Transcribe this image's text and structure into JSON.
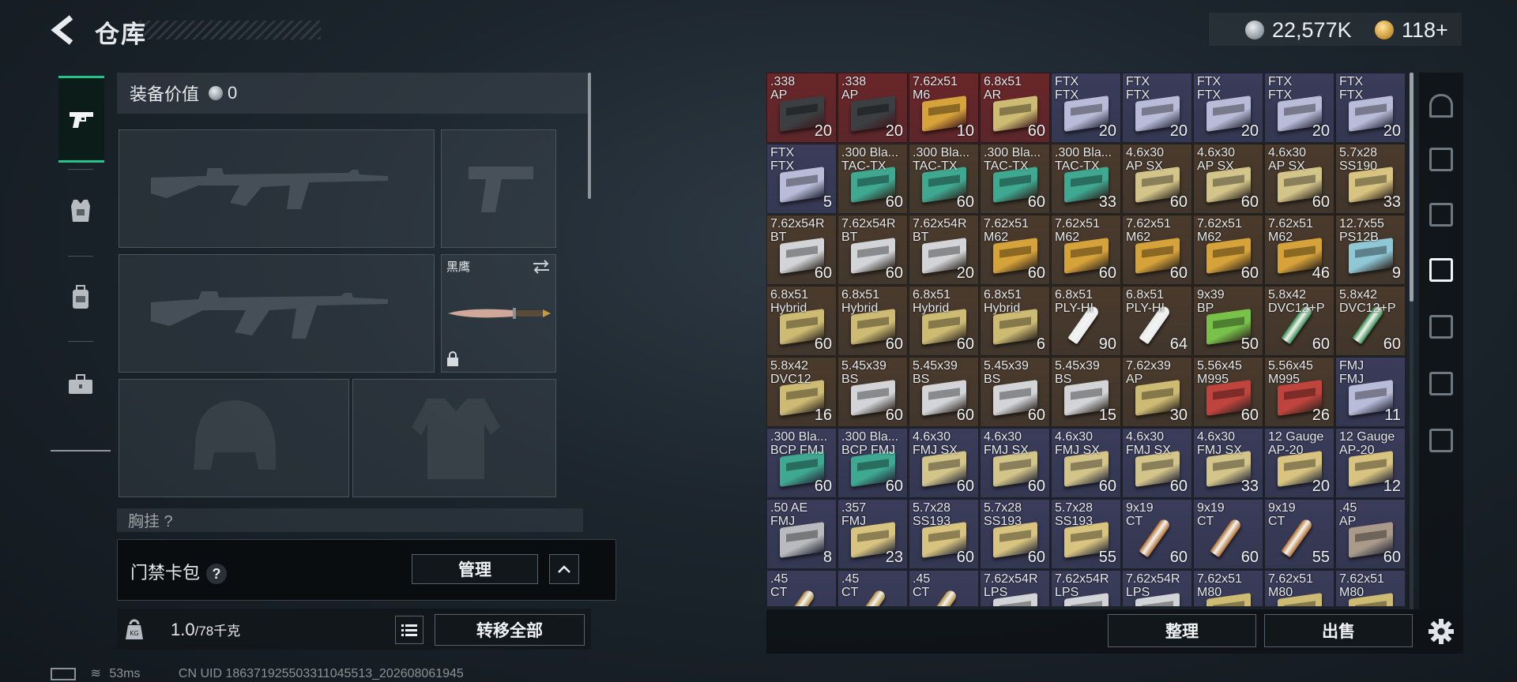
{
  "header": {
    "title": "仓库",
    "currencies": [
      {
        "icon": "silver-coin-icon",
        "value": "22,577K"
      },
      {
        "icon": "gold-coin-icon",
        "value": "118+"
      }
    ]
  },
  "left_rail": {
    "items": [
      {
        "icon": "pistol-icon",
        "active": true
      },
      {
        "icon": "armor-vest-icon",
        "active": false
      },
      {
        "icon": "backpack-icon",
        "active": false
      },
      {
        "icon": "toolbox-icon",
        "active": false
      }
    ]
  },
  "equipment": {
    "value_label": "装备价值",
    "value": "0",
    "melee_name": "黑鹰",
    "chest_rig_label": "胸挂 ?",
    "key_bag_label": "门禁卡包",
    "help_mark": "?",
    "manage_label": "管理",
    "weight_value": "1.0",
    "weight_max": "/78千克",
    "transfer_all_label": "转移全部"
  },
  "status_bar": {
    "ping": "53ms",
    "uid": "CN UID 186371925503311045513_202608061945"
  },
  "inventory": {
    "columns": 9,
    "items": [
      {
        "name": ".338\nAP",
        "count": "20",
        "bg": "#6a2629",
        "box": "#3b3f42"
      },
      {
        "name": ".338\nAP",
        "count": "20",
        "bg": "#6a2629",
        "box": "#3b3f42"
      },
      {
        "name": "7.62x51\nM6",
        "count": "10",
        "bg": "#6a2629",
        "box": "#d6a23a"
      },
      {
        "name": "6.8x51\nAR",
        "count": "60",
        "bg": "#6a2629",
        "box": "#cdbb74"
      },
      {
        "name": "FTX\nFTX",
        "count": "20",
        "bg": "#3a3c5a",
        "box": "#b9bcd8"
      },
      {
        "name": "FTX\nFTX",
        "count": "20",
        "bg": "#3a3c5a",
        "box": "#b9bcd8"
      },
      {
        "name": "FTX\nFTX",
        "count": "20",
        "bg": "#3a3c5a",
        "box": "#b9bcd8"
      },
      {
        "name": "FTX\nFTX",
        "count": "20",
        "bg": "#3a3c5a",
        "box": "#b9bcd8"
      },
      {
        "name": "FTX\nFTX",
        "count": "20",
        "bg": "#3a3c5a",
        "box": "#b9bcd8"
      },
      {
        "name": "FTX\nFTX",
        "count": "5",
        "bg": "#3a3c5a",
        "box": "#b9bcd8"
      },
      {
        "name": ".300 Bla...\nTAC-TX",
        "count": "60",
        "bg": "#4a3a2c",
        "box": "#3fa891"
      },
      {
        "name": ".300 Bla...\nTAC-TX",
        "count": "60",
        "bg": "#4a3a2c",
        "box": "#3fa891"
      },
      {
        "name": ".300 Bla...\nTAC-TX",
        "count": "60",
        "bg": "#4a3a2c",
        "box": "#3fa891"
      },
      {
        "name": ".300 Bla...\nTAC-TX",
        "count": "33",
        "bg": "#4a3a2c",
        "box": "#3fa891"
      },
      {
        "name": "4.6x30\nAP SX",
        "count": "60",
        "bg": "#4a3a2c",
        "box": "#d3c48a"
      },
      {
        "name": "4.6x30\nAP SX",
        "count": "60",
        "bg": "#4a3a2c",
        "box": "#d3c48a"
      },
      {
        "name": "4.6x30\nAP SX",
        "count": "60",
        "bg": "#4a3a2c",
        "box": "#d3c48a"
      },
      {
        "name": "5.7x28\nSS190",
        "count": "33",
        "bg": "#4a3a2c",
        "box": "#d8c480"
      },
      {
        "name": "7.62x54R\nBT",
        "count": "60",
        "bg": "#4a3a2c",
        "box": "#d2d4d8"
      },
      {
        "name": "7.62x54R\nBT",
        "count": "60",
        "bg": "#4a3a2c",
        "box": "#d2d4d8"
      },
      {
        "name": "7.62x54R\nBT",
        "count": "20",
        "bg": "#4a3a2c",
        "box": "#d2d4d8"
      },
      {
        "name": "7.62x51\nM62",
        "count": "60",
        "bg": "#4a3a2c",
        "box": "#d6a23a"
      },
      {
        "name": "7.62x51\nM62",
        "count": "60",
        "bg": "#4a3a2c",
        "box": "#d6a23a"
      },
      {
        "name": "7.62x51\nM62",
        "count": "60",
        "bg": "#4a3a2c",
        "box": "#d6a23a"
      },
      {
        "name": "7.62x51\nM62",
        "count": "60",
        "bg": "#4a3a2c",
        "box": "#d6a23a"
      },
      {
        "name": "7.62x51\nM62",
        "count": "46",
        "bg": "#4a3a2c",
        "box": "#d6a23a"
      },
      {
        "name": "12.7x55\nPS12B",
        "count": "9",
        "bg": "#4a3a2c",
        "box": "#8fc7d6"
      },
      {
        "name": "6.8x51\nHybrid",
        "count": "60",
        "bg": "#4a3a2c",
        "box": "#cdbb74"
      },
      {
        "name": "6.8x51\nHybrid",
        "count": "60",
        "bg": "#4a3a2c",
        "box": "#cdbb74"
      },
      {
        "name": "6.8x51\nHybrid",
        "count": "60",
        "bg": "#4a3a2c",
        "box": "#cdbb74"
      },
      {
        "name": "6.8x51\nHybrid",
        "count": "6",
        "bg": "#4a3a2c",
        "box": "#cdbb74"
      },
      {
        "name": "6.8x51\nPLY-HI",
        "count": "90",
        "bg": "#4a3a2c",
        "bullet": "#e8ecef"
      },
      {
        "name": "6.8x51\nPLY-HI",
        "count": "64",
        "bg": "#4a3a2c",
        "bullet": "#e8ecef"
      },
      {
        "name": "9x39\nBP",
        "count": "50",
        "bg": "#4a3a2c",
        "box": "#79c24a"
      },
      {
        "name": "5.8x42\nDVC12+P",
        "count": "60",
        "bg": "#4a3a2c",
        "bullet": "#2f8a4c"
      },
      {
        "name": "5.8x42\nDVC12+P",
        "count": "60",
        "bg": "#4a3a2c",
        "bullet": "#2f8a4c"
      },
      {
        "name": "5.8x42\nDVC12",
        "count": "16",
        "bg": "#4a3a2c",
        "box": "#cdbb74"
      },
      {
        "name": "5.45x39\nBS",
        "count": "60",
        "bg": "#4a3a2c",
        "box": "#d2d4d8"
      },
      {
        "name": "5.45x39\nBS",
        "count": "60",
        "bg": "#4a3a2c",
        "box": "#d2d4d8"
      },
      {
        "name": "5.45x39\nBS",
        "count": "60",
        "bg": "#4a3a2c",
        "box": "#d2d4d8"
      },
      {
        "name": "5.45x39\nBS",
        "count": "15",
        "bg": "#4a3a2c",
        "box": "#d2d4d8"
      },
      {
        "name": "7.62x39\nAP",
        "count": "30",
        "bg": "#4a3a2c",
        "box": "#cdbb74"
      },
      {
        "name": "5.56x45\nM995",
        "count": "60",
        "bg": "#4a3a2c",
        "box": "#c0443e"
      },
      {
        "name": "5.56x45\nM995",
        "count": "26",
        "bg": "#4a3a2c",
        "box": "#c0443e"
      },
      {
        "name": "FMJ\nFMJ",
        "count": "11",
        "bg": "#3a3c5a",
        "box": "#b9bcd8"
      },
      {
        "name": ".300 Bla...\nBCP FMJ",
        "count": "60",
        "bg": "#3a3c5a",
        "box": "#3fa891"
      },
      {
        "name": ".300 Bla...\nBCP FMJ",
        "count": "60",
        "bg": "#3a3c5a",
        "box": "#3fa891"
      },
      {
        "name": "4.6x30\nFMJ SX",
        "count": "60",
        "bg": "#3a3c5a",
        "box": "#d3c48a"
      },
      {
        "name": "4.6x30\nFMJ SX",
        "count": "60",
        "bg": "#3a3c5a",
        "box": "#d3c48a"
      },
      {
        "name": "4.6x30\nFMJ SX",
        "count": "60",
        "bg": "#3a3c5a",
        "box": "#d3c48a"
      },
      {
        "name": "4.6x30\nFMJ SX",
        "count": "60",
        "bg": "#3a3c5a",
        "box": "#d3c48a"
      },
      {
        "name": "4.6x30\nFMJ SX",
        "count": "33",
        "bg": "#3a3c5a",
        "box": "#d3c48a"
      },
      {
        "name": "12 Gauge\nAP-20",
        "count": "20",
        "bg": "#3a3c5a",
        "box": "#d8c480"
      },
      {
        "name": "12 Gauge\nAP-20",
        "count": "12",
        "bg": "#3a3c5a",
        "box": "#d8c480"
      },
      {
        "name": ".50 AE\nFMJ",
        "count": "8",
        "bg": "#3a3c5a",
        "box": "#b8babd"
      },
      {
        "name": ".357\nFMJ",
        "count": "23",
        "bg": "#3a3c5a",
        "box": "#d8c480"
      },
      {
        "name": "5.7x28\nSS193",
        "count": "60",
        "bg": "#3a3c5a",
        "box": "#d8c480"
      },
      {
        "name": "5.7x28\nSS193",
        "count": "60",
        "bg": "#3a3c5a",
        "box": "#d8c480"
      },
      {
        "name": "5.7x28\nSS193",
        "count": "55",
        "bg": "#3a3c5a",
        "box": "#d8c480"
      },
      {
        "name": "9x19\nCT",
        "count": "60",
        "bg": "#3a3c5a",
        "bullet": "#b06c2c"
      },
      {
        "name": "9x19\nCT",
        "count": "60",
        "bg": "#3a3c5a",
        "bullet": "#b06c2c"
      },
      {
        "name": "9x19\nCT",
        "count": "55",
        "bg": "#3a3c5a",
        "bullet": "#b06c2c"
      },
      {
        "name": ".45\nAP",
        "count": "60",
        "bg": "#3a3c5a",
        "box": "#a99a8a"
      },
      {
        "name": ".45\nCT",
        "count": "",
        "bg": "#3a3c5a",
        "bullet": "#b08a3c"
      },
      {
        "name": ".45\nCT",
        "count": "",
        "bg": "#3a3c5a",
        "bullet": "#b08a3c"
      },
      {
        "name": ".45\nCT",
        "count": "",
        "bg": "#3a3c5a",
        "bullet": "#b08a3c"
      },
      {
        "name": "7.62x54R\nLPS",
        "count": "",
        "bg": "#3a3c5a",
        "box": "#d2d4d8"
      },
      {
        "name": "7.62x54R\nLPS",
        "count": "",
        "bg": "#3a3c5a",
        "box": "#d2d4d8"
      },
      {
        "name": "7.62x54R\nLPS",
        "count": "",
        "bg": "#3a3c5a",
        "box": "#d2d4d8"
      },
      {
        "name": "7.62x51\nM80",
        "count": "",
        "bg": "#3a3c5a",
        "box": "#cdbb74"
      },
      {
        "name": "7.62x51\nM80",
        "count": "",
        "bg": "#3a3c5a",
        "box": "#cdbb74"
      },
      {
        "name": "7.62x51\nM80",
        "count": "",
        "bg": "#3a3c5a",
        "box": "#cdbb74"
      }
    ]
  },
  "side_tabs": [
    {
      "icon": "helmet-tab-icon"
    },
    {
      "icon": "tier-3-container-icon"
    },
    {
      "icon": "tier-4-case-icon"
    },
    {
      "icon": "tier-4-folder-icon",
      "active": true
    },
    {
      "icon": "tier-3-box-icon"
    },
    {
      "icon": "tier-4-add-icon"
    },
    {
      "icon": "tier-3-chest-icon"
    }
  ],
  "actions": {
    "sort_label": "整理",
    "sell_label": "出售"
  }
}
